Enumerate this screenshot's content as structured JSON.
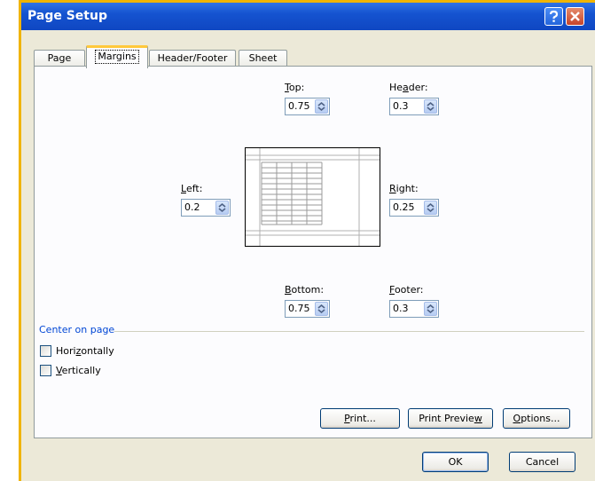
{
  "window": {
    "title": "Page Setup",
    "help_icon": "question-icon",
    "close_icon": "close-icon"
  },
  "tabs": [
    {
      "label": "Page",
      "active": false
    },
    {
      "label": "Margins",
      "active": true
    },
    {
      "label": "Header/Footer",
      "active": false
    },
    {
      "label": "Sheet",
      "active": false
    }
  ],
  "margins": {
    "top": {
      "label_pre": "",
      "label_key": "T",
      "label_post": "op:",
      "value": "0.75"
    },
    "header": {
      "label_pre": "He",
      "label_key": "a",
      "label_post": "der:",
      "value": "0.3"
    },
    "left": {
      "label_pre": "",
      "label_key": "L",
      "label_post": "eft:",
      "value": "0.2"
    },
    "right": {
      "label_pre": "",
      "label_key": "R",
      "label_post": "ight:",
      "value": "0.25"
    },
    "bottom": {
      "label_pre": "",
      "label_key": "B",
      "label_post": "ottom:",
      "value": "0.75"
    },
    "footer": {
      "label_pre": "",
      "label_key": "F",
      "label_post": "ooter:",
      "value": "0.3"
    }
  },
  "center_on_page": {
    "title": "Center on page",
    "horizontally": {
      "pre": "Hori",
      "key": "z",
      "post": "ontally",
      "checked": false
    },
    "vertically": {
      "pre": "",
      "key": "V",
      "post": "ertically",
      "checked": false
    }
  },
  "buttons": {
    "print": {
      "pre": "",
      "key": "P",
      "post": "rint..."
    },
    "print_preview": {
      "pre": "Print Previe",
      "key": "w",
      "post": ""
    },
    "options": {
      "pre": "",
      "key": "O",
      "post": "ptions..."
    },
    "ok": "OK",
    "cancel": "Cancel"
  },
  "colors": {
    "titlebar": "#1553d0",
    "group_title": "#0046d5",
    "active_tab_highlight": "#ffc83c",
    "window_frame": "#f0b400"
  }
}
